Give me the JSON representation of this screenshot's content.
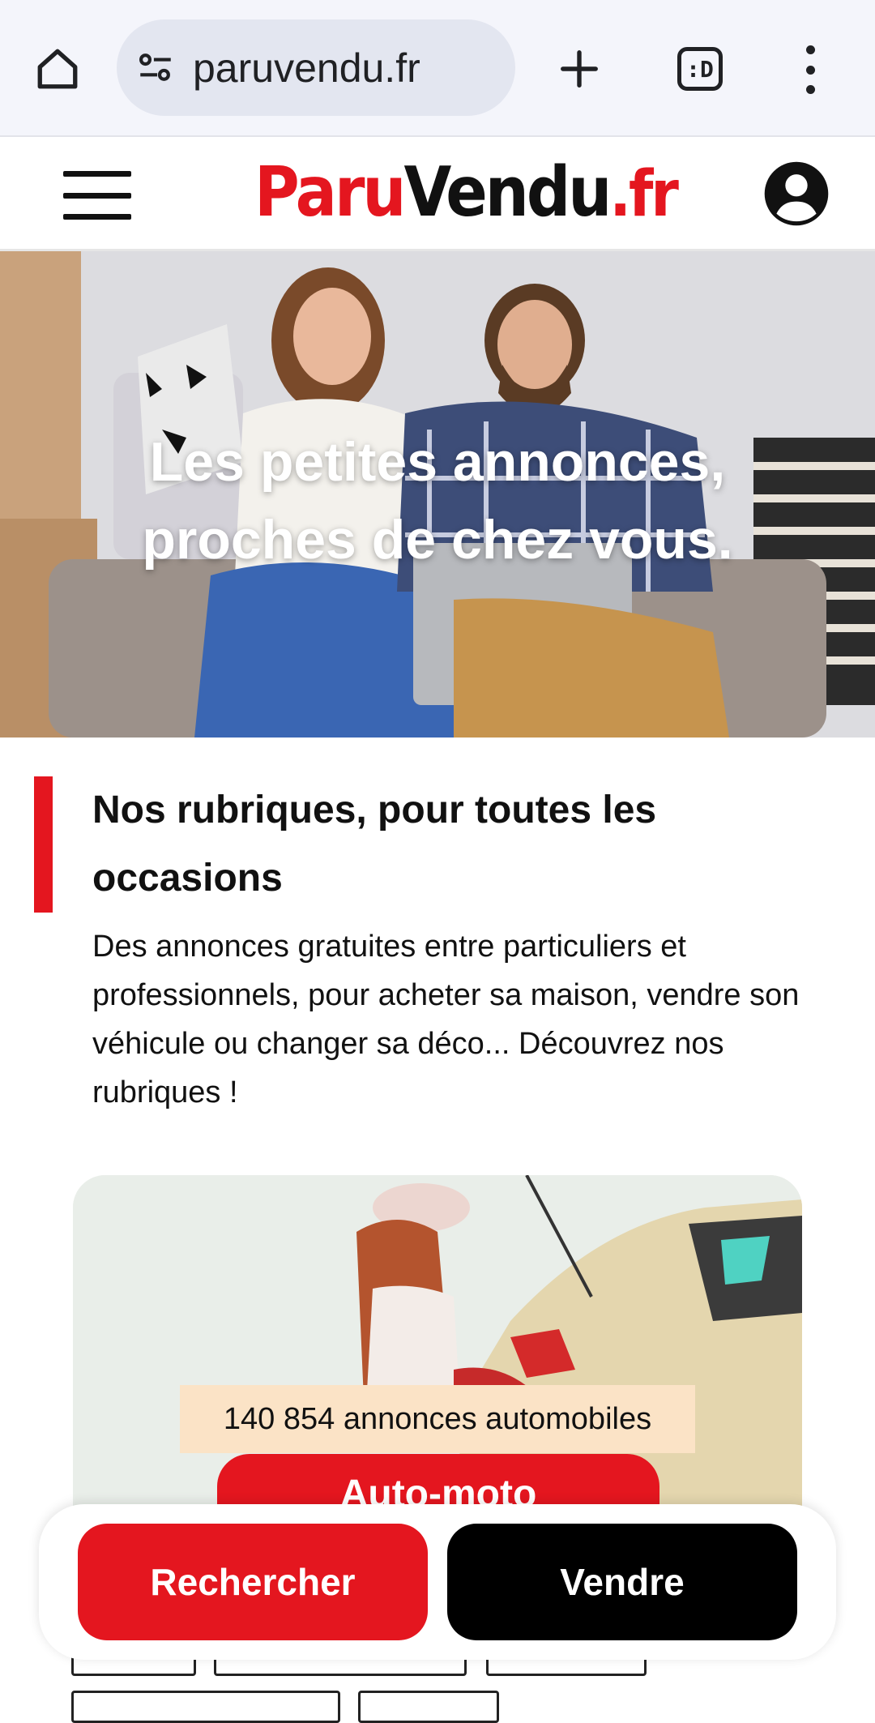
{
  "browser": {
    "url": "paruvendu.fr",
    "tabs_glyph": ":D"
  },
  "header": {
    "logo_part1": "Paru",
    "logo_part2": "Vendu",
    "logo_part3": ".fr"
  },
  "hero": {
    "line1": "Les petites annonces,",
    "line2_a": "proches de ",
    "line2_b": "chez vous."
  },
  "section": {
    "title": "Nos rubriques, pour toutes les occasions",
    "description": "Des annonces gratuites entre particuliers et professionnels, pour acheter sa maison, vendre son véhicule ou changer sa déco... Découvrez nos rubriques !"
  },
  "category_card": {
    "count_text": "140 854 annonces automobiles",
    "button_label": "Auto-moto"
  },
  "actions": {
    "search_label": "Rechercher",
    "sell_label": "Vendre"
  },
  "colors": {
    "brand_red": "#e4161f",
    "black": "#000000"
  },
  "icons": [
    "home-icon",
    "site-settings-icon",
    "new-tab-icon",
    "tab-switcher-icon",
    "more-vert-icon",
    "hamburger-menu-icon",
    "account-circle-icon"
  ]
}
